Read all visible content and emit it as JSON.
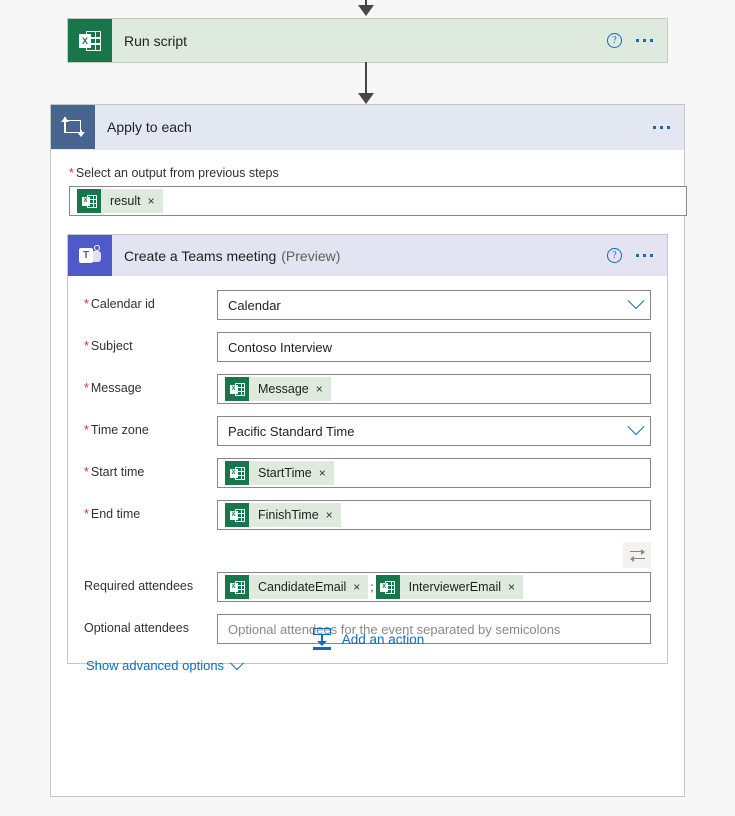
{
  "colors": {
    "page_background": "#f7f7f7",
    "run_script_card": "#dfeade",
    "excel_green": "#17764a",
    "loop_blue": "#486591",
    "teams_purple": "#5059c9",
    "apply_header": "#e3e7f1",
    "teams_header": "#e3e3f1",
    "link_blue": "#0f6cbd",
    "required_red": "#d13438",
    "arrow_gray": "#484644"
  },
  "run_script_card": {
    "title": "Run script",
    "icon": "excel-icon",
    "help_icon": "help-circle-icon",
    "menu_icon": "more-options-icon"
  },
  "apply_to_each": {
    "title": "Apply to each",
    "icon": "loop-icon",
    "menu_icon": "more-options-icon",
    "output_field": {
      "label": "Select an output from previous steps",
      "required": true,
      "tokens": [
        {
          "label": "result",
          "icon": "excel-icon",
          "remove": "×"
        }
      ]
    }
  },
  "teams_action": {
    "title": "Create a Teams meeting",
    "preview_tag": "(Preview)",
    "icon": "teams-icon",
    "help_icon": "help-circle-icon",
    "menu_icon": "more-options-icon",
    "fields": [
      {
        "label": "Calendar id",
        "required": true,
        "type": "combo",
        "value": "Calendar",
        "chevron": "chevron-down-icon"
      },
      {
        "label": "Subject",
        "required": true,
        "type": "text",
        "value": "Contoso Interview"
      },
      {
        "label": "Message",
        "required": true,
        "type": "tokens",
        "tokens": [
          {
            "label": "Message",
            "icon": "excel-icon",
            "remove": "×"
          }
        ]
      },
      {
        "label": "Time zone",
        "required": true,
        "type": "combo",
        "value": "Pacific Standard Time",
        "chevron": "chevron-down-icon"
      },
      {
        "label": "Start time",
        "required": true,
        "type": "tokens",
        "tokens": [
          {
            "label": "StartTime",
            "icon": "excel-icon",
            "remove": "×"
          }
        ]
      },
      {
        "label": "End time",
        "required": true,
        "type": "tokens",
        "tokens": [
          {
            "label": "FinishTime",
            "icon": "excel-icon",
            "remove": "×"
          }
        ]
      },
      {
        "label": "Required attendees",
        "required": false,
        "type": "tokens",
        "separator": ";",
        "tokens": [
          {
            "label": "CandidateEmail",
            "icon": "excel-icon",
            "remove": "×"
          },
          {
            "label": "InterviewerEmail",
            "icon": "excel-icon",
            "remove": "×"
          }
        ]
      },
      {
        "label": "Optional attendees",
        "required": false,
        "type": "text",
        "value": "",
        "placeholder": "Optional attendees for the event separated by semicolons"
      }
    ],
    "swap_button": "swap-inputs-icon",
    "advanced_options": {
      "label": "Show advanced options",
      "chevron": "chevron-down-icon"
    }
  },
  "add_action": {
    "label": "Add an action",
    "icon": "insert-below-icon"
  }
}
